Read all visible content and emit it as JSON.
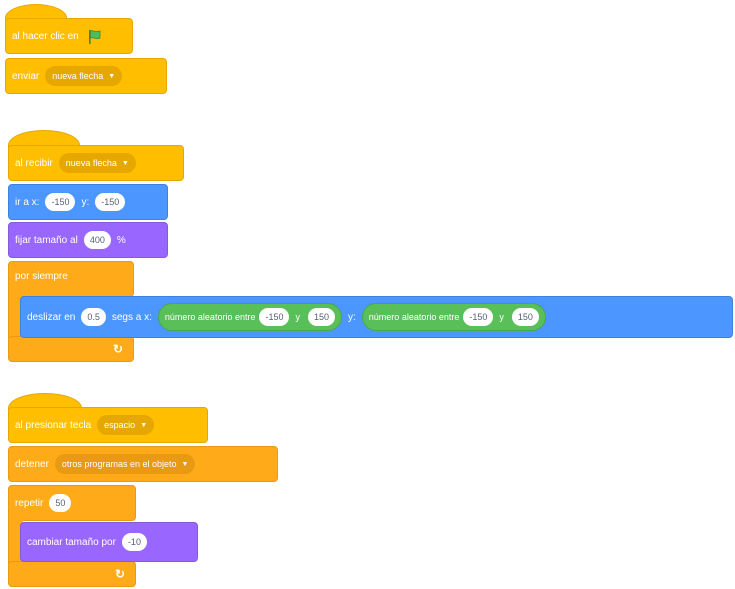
{
  "script1": {
    "hat_label": "al hacer clic en",
    "send_label": "enviar",
    "send_message": "nueva flecha"
  },
  "script2": {
    "hat_label": "al recibir",
    "hat_message": "nueva flecha",
    "goto_label": "ir a x:",
    "goto_x": "-150",
    "goto_y_label": "y:",
    "goto_y": "-150",
    "size_label": "fijar tamaño al",
    "size_value": "400",
    "size_unit": "%",
    "forever_label": "por siempre",
    "glide_label": "deslizar en",
    "glide_secs": "0.5",
    "glide_mid": "segs a x:",
    "rand1_label": "número aleatorio entre",
    "rand1_from": "-150",
    "rand1_and": "y",
    "rand1_to": "150",
    "glide_y_label": "y:",
    "rand2_label": "número aleatorio entre",
    "rand2_from": "-150",
    "rand2_and": "y",
    "rand2_to": "150"
  },
  "script3": {
    "hat_label": "al presionar tecla",
    "hat_key": "espacio",
    "stop_label": "detener",
    "stop_option": "otros programas en el objeto",
    "repeat_label": "repetir",
    "repeat_value": "50",
    "change_label": "cambiar tamaño por",
    "change_value": "-10"
  },
  "icons": {
    "flag": "green-flag-icon",
    "loop_arrow": "loop-arrow-icon",
    "dropdown": "caret-down-icon"
  },
  "colors": {
    "events": "#FFBF00",
    "control": "#FFAB19",
    "motion": "#4C97FF",
    "looks": "#9966FF",
    "operators": "#59C059"
  }
}
